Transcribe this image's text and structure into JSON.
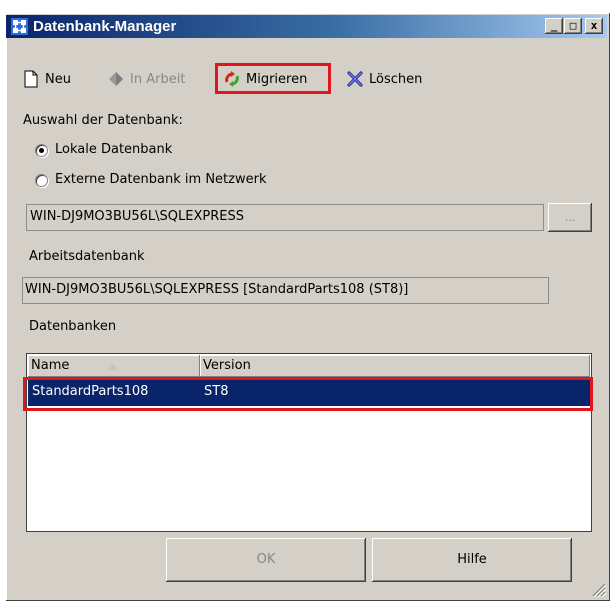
{
  "window": {
    "title": "Datenbank-Manager",
    "controls": {
      "minimize": "_",
      "maximize": "□",
      "close": "x"
    }
  },
  "toolbar": {
    "new_label": "Neu",
    "inwork_label": "In Arbeit",
    "migrate_label": "Migrieren",
    "delete_label": "Löschen"
  },
  "selection": {
    "label": "Auswahl der Datenbank:",
    "options": [
      {
        "label": "Lokale Datenbank",
        "checked": true
      },
      {
        "label": "Externe Datenbank im Netzwerk",
        "checked": false
      }
    ]
  },
  "server": {
    "value": "WIN-DJ9MO3BU56L\\SQLEXPRESS",
    "browse_label": "..."
  },
  "workdb": {
    "label": "Arbeitsdatenbank",
    "value": "WIN-DJ9MO3BU56L\\SQLEXPRESS [StandardParts108 (ST8)]"
  },
  "databases": {
    "label": "Datenbanken",
    "columns": [
      "Name",
      "Version"
    ],
    "rows": [
      {
        "name": "StandardParts108",
        "version": "ST8",
        "selected": true
      }
    ]
  },
  "buttons": {
    "ok": "OK",
    "help": "Hilfe"
  },
  "colors": {
    "highlight": "#e0161f",
    "selection": "#0a246a",
    "titlebar": "#0a246a"
  }
}
